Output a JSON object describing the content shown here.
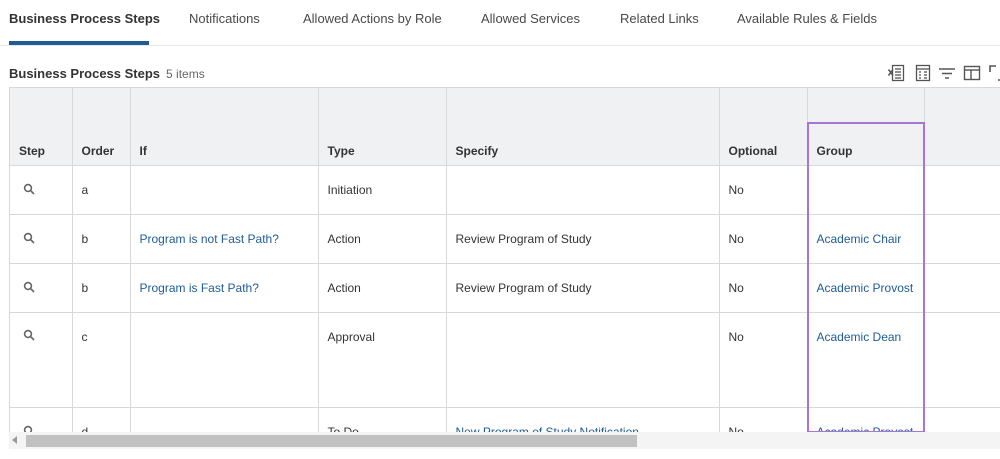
{
  "tabs": [
    {
      "label": "Business Process Steps",
      "active": true
    },
    {
      "label": "Notifications"
    },
    {
      "label": "Allowed Actions by Role"
    },
    {
      "label": "Allowed Services"
    },
    {
      "label": "Related Links"
    },
    {
      "label": "Available Rules & Fields"
    }
  ],
  "grid": {
    "title": "Business Process Steps",
    "item_count": "5 items",
    "toolbar_icons": [
      "export-to-excel-icon",
      "export-to-worksheets-icon",
      "filter-icon",
      "column-layout-icon",
      "fullscreen-icon"
    ],
    "columns": [
      "Step",
      "Order",
      "If",
      "Type",
      "Specify",
      "Optional",
      "Group"
    ],
    "rows": [
      {
        "order": "a",
        "if": "",
        "type": "Initiation",
        "specify": "",
        "optional": "No",
        "group": ""
      },
      {
        "order": "b",
        "if": "Program is not Fast Path?",
        "type": "Action",
        "specify": "Review Program of Study",
        "optional": "No",
        "group": "Academic Chair"
      },
      {
        "order": "b",
        "if": "Program is Fast Path?",
        "type": "Action",
        "specify": "Review Program of Study",
        "optional": "No",
        "group": "Academic Provost"
      },
      {
        "order": "c",
        "if": "",
        "type": "Approval",
        "specify": "",
        "optional": "No",
        "group": "Academic Dean"
      },
      {
        "order": "d",
        "if": "",
        "type": "To Do",
        "specify": "New Program of Study Notification",
        "optional": "No",
        "group": "Academic Provost"
      }
    ]
  },
  "colors": {
    "link": "#1f5c96",
    "active_tab_underline": "#1f5c96",
    "header_bg": "#f0f1f2",
    "highlight_border": "#a874d6"
  }
}
